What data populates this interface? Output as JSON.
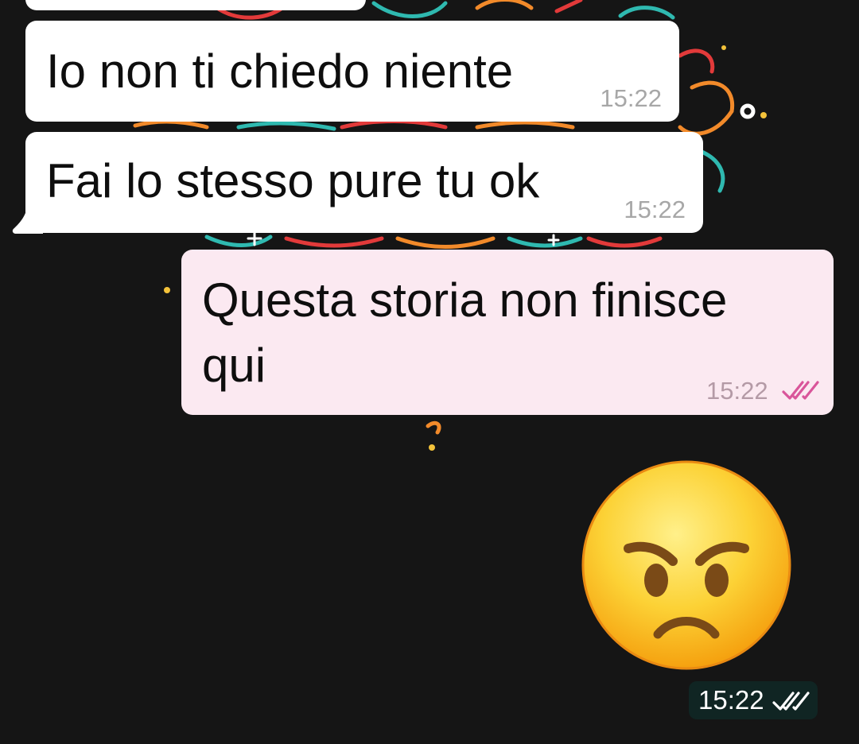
{
  "chat": {
    "messages": [
      {
        "direction": "incoming",
        "text": "",
        "time": ""
      },
      {
        "direction": "incoming",
        "text": "Io non ti chiedo niente",
        "time": "15:22"
      },
      {
        "direction": "incoming",
        "text": "Fai lo stesso pure tu ok",
        "time": "15:22"
      },
      {
        "direction": "outgoing",
        "text_lines": [
          "Questa storia non finisce",
          "qui"
        ],
        "time": "15:22",
        "status_icon": "double-check-icon"
      },
      {
        "direction": "outgoing",
        "emoji": "angry-face-emoji",
        "time": "15:22",
        "status_icon": "double-check-icon"
      }
    ]
  },
  "colors": {
    "background": "#151515",
    "incoming_bubble": "#ffffff",
    "outgoing_bubble": "#fbe9f1",
    "time_incoming": "#a7a7a7",
    "time_outgoing": "#b49aa6",
    "read_check_outgoing": "#d9559a",
    "emoji_time_pill": "#102523"
  }
}
